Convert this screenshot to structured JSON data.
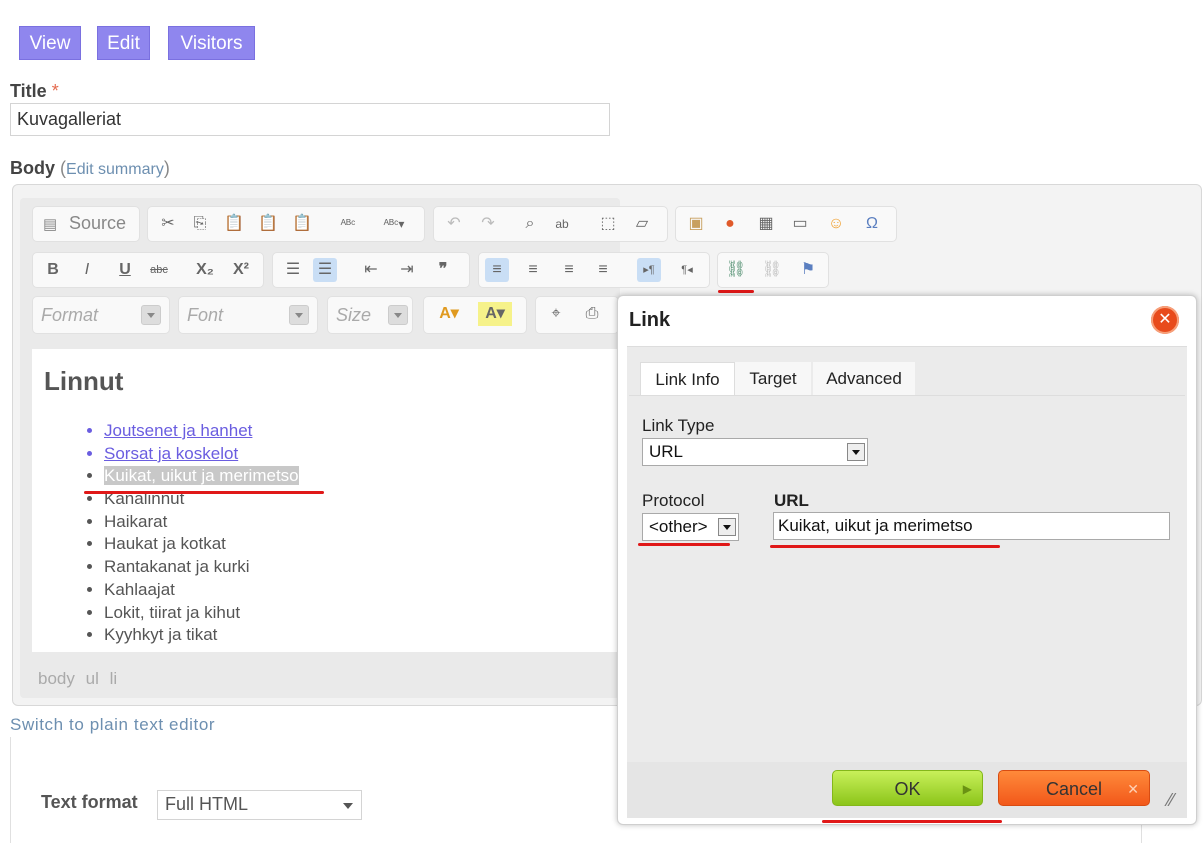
{
  "tabs": {
    "view": "View",
    "edit": "Edit",
    "visitors": "Visitors"
  },
  "title_field": {
    "label": "Title",
    "required_mark": "*",
    "value": "Kuvagalleriat"
  },
  "body_field": {
    "label": "Body",
    "paren_open": "(",
    "edit_summary": "Edit summary",
    "paren_close": ")"
  },
  "toolbar": {
    "source": "Source",
    "format_placeholder": "Format",
    "font_placeholder": "Font",
    "size_placeholder": "Size"
  },
  "content": {
    "heading": "Linnut",
    "items": [
      {
        "text": "Joutsenet ja hanhet",
        "link": true
      },
      {
        "text": "Sorsat ja koskelot",
        "link": true
      },
      {
        "text": "Kuikat, uikut ja merimetso",
        "selected": true
      },
      {
        "text": "Kanalinnut"
      },
      {
        "text": "Haikarat"
      },
      {
        "text": "Haukat ja kotkat"
      },
      {
        "text": "Rantakanat ja kurki"
      },
      {
        "text": "Kahlaajat"
      },
      {
        "text": "Lokit, tiirat ja kihut"
      },
      {
        "text": "Kyyhkyt ja tikat"
      }
    ]
  },
  "path_bar": [
    "body",
    "ul",
    "li"
  ],
  "switch_link": "Switch to plain text editor",
  "text_format": {
    "label": "Text format",
    "value": "Full HTML"
  },
  "dialog": {
    "title": "Link",
    "tabs": [
      "Link Info",
      "Target",
      "Advanced"
    ],
    "link_type_label": "Link Type",
    "link_type_value": "URL",
    "protocol_label": "Protocol",
    "protocol_value": "<other>",
    "url_label": "URL",
    "url_value": "Kuikat, uikut ja merimetso",
    "ok": "OK",
    "cancel": "Cancel"
  },
  "colors": {
    "tab_bg": "#8f86ee",
    "link": "#6a5de0",
    "annotation_red": "#e01818",
    "ok_green": "#8cc51a",
    "cancel_orange": "#f2581a"
  }
}
